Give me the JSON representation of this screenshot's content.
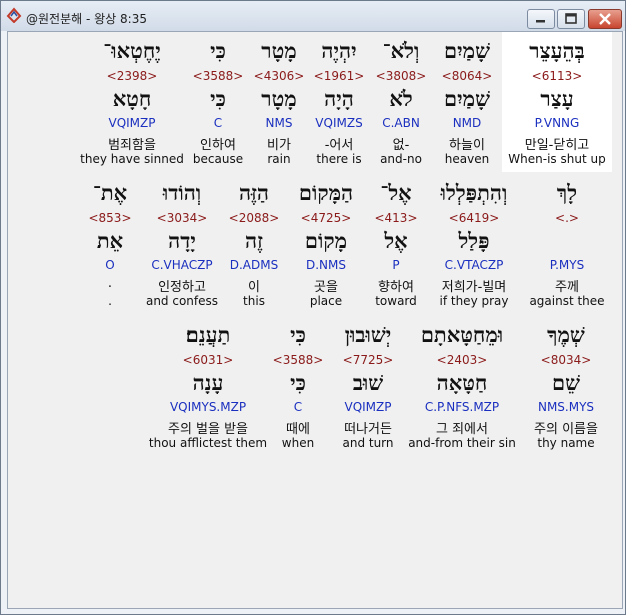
{
  "window": {
    "title": "@원전분해 - 왕상 8:35"
  },
  "rows": [
    {
      "cells": [
        {
          "heb": "בְּהֵעָצֵר",
          "strong": "<6113>",
          "lemma": "עָצַר",
          "parse": "P.VNNG",
          "kor": "만일-닫히고",
          "eng": "When-is shut up",
          "highlight": true
        },
        {
          "heb": "שָׁמַיִם",
          "strong": "<8064>",
          "lemma": "שָׁמַיִם",
          "parse": "NMD",
          "kor": "하늘이",
          "eng": "heaven"
        },
        {
          "heb": "וְלֹא־",
          "strong": "<3808>",
          "lemma": "לֹא",
          "parse": "C.ABN",
          "kor": "없-",
          "eng": "and-no"
        },
        {
          "heb": "יִהְיֶה",
          "strong": "<1961>",
          "lemma": "הָיָה",
          "parse": "VQIMZS",
          "kor": "-어서",
          "eng": "there is"
        },
        {
          "heb": "מָטָר",
          "strong": "<4306>",
          "lemma": "מָטָר",
          "parse": "NMS",
          "kor": "비가",
          "eng": "rain"
        },
        {
          "heb": "כִּי",
          "strong": "<3588>",
          "lemma": "כִּי",
          "parse": "C",
          "kor": "인하여",
          "eng": "because"
        },
        {
          "heb": "יֶחֶטְאוּ־",
          "strong": "<2398>",
          "lemma": "חָטָא",
          "parse": "VQIMZP",
          "kor": "범죄함을",
          "eng": "they have sinned"
        }
      ]
    },
    {
      "cells": [
        {
          "heb": "לָךְ",
          "strong": "<.>",
          "lemma": "",
          "parse": "P.MYS",
          "kor": "주께",
          "eng": "against thee"
        },
        {
          "heb": "וְהִתְפַּלְלוּ",
          "strong": "<6419>",
          "lemma": "פָּלַל",
          "parse": "C.VTACZP",
          "kor": "저희가-빌며",
          "eng": "if they pray"
        },
        {
          "heb": "אֶל־",
          "strong": "<413>",
          "lemma": "אֶל",
          "parse": "P",
          "kor": "향하여",
          "eng": "toward"
        },
        {
          "heb": "הַמָּקוֹם",
          "strong": "<4725>",
          "lemma": "מָקוֹם",
          "parse": "D.NMS",
          "kor": "곳을",
          "eng": "place"
        },
        {
          "heb": "הַזֶּה",
          "strong": "<2088>",
          "lemma": "זֶה",
          "parse": "D.ADMS",
          "kor": "이",
          "eng": "this"
        },
        {
          "heb": "וְהוֹדוּ",
          "strong": "<3034>",
          "lemma": "יָדָה",
          "parse": "C.VHACZP",
          "kor": "인정하고",
          "eng": "and confess"
        },
        {
          "heb": "אֶת־",
          "strong": "<853>",
          "lemma": "אֵת",
          "parse": "O",
          "kor": ".",
          "eng": "."
        }
      ]
    },
    {
      "cells": [
        {
          "heb": "שְׁמֶךָ",
          "strong": "<8034>",
          "lemma": "שֵׁם",
          "parse": "NMS.MYS",
          "kor": "주의 이름을",
          "eng": "thy name"
        },
        {
          "heb": "וּמֵחַטָּאתָם",
          "strong": "<2403>",
          "lemma": "חַטָּאָה",
          "parse": "C.P.NFS.MZP",
          "kor": "그 죄에서",
          "eng": "and-from their sin"
        },
        {
          "heb": "יְשׁוּבוּן",
          "strong": "<7725>",
          "lemma": "שׁוּב",
          "parse": "VQIMZP",
          "kor": "떠나거든",
          "eng": "and turn"
        },
        {
          "heb": "כִּי",
          "strong": "<3588>",
          "lemma": "כִּי",
          "parse": "C",
          "kor": "때에",
          "eng": "when"
        },
        {
          "heb": "תַעֲנֵם׃",
          "strong": "<6031>",
          "lemma": "עָנָה",
          "parse": "VQIMYS.MZP",
          "kor": "주의 벌을 받을",
          "eng": "thou afflictest them"
        }
      ]
    }
  ]
}
